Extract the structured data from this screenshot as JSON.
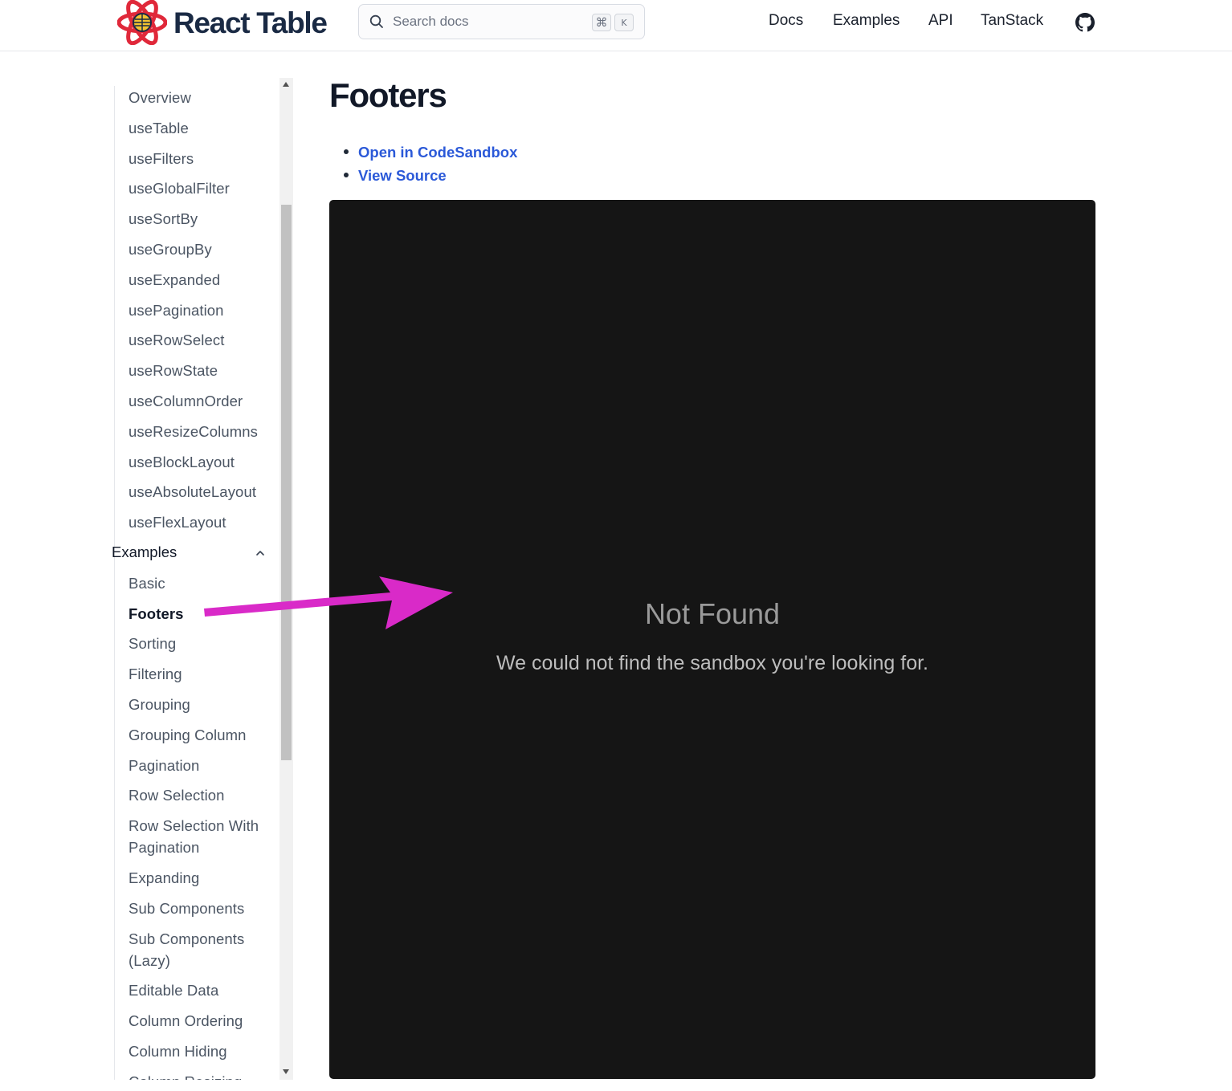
{
  "header": {
    "logo_text": "React Table",
    "search": {
      "placeholder": "Search docs",
      "shortcut_keys": [
        "⌘",
        "K"
      ]
    },
    "nav": [
      "Docs",
      "Examples",
      "API",
      "TanStack"
    ],
    "github_icon": "github-icon"
  },
  "sidebar": {
    "api_items": [
      "Overview",
      "useTable",
      "useFilters",
      "useGlobalFilter",
      "useSortBy",
      "useGroupBy",
      "useExpanded",
      "usePagination",
      "useRowSelect",
      "useRowState",
      "useColumnOrder",
      "useResizeColumns",
      "useBlockLayout",
      "useAbsoluteLayout",
      "useFlexLayout"
    ],
    "examples_section": "Examples",
    "example_items": [
      "Basic",
      "Footers",
      "Sorting",
      "Filtering",
      "Grouping",
      "Grouping Column",
      "Pagination",
      "Row Selection",
      "Row Selection With Pagination",
      "Expanding",
      "Sub Components",
      "Sub Components (Lazy)",
      "Editable Data",
      "Column Ordering",
      "Column Hiding",
      "Column Resizing"
    ],
    "active_item": "Footers"
  },
  "main": {
    "title": "Footers",
    "links": [
      "Open in CodeSandbox",
      "View Source"
    ],
    "sandbox": {
      "title": "Not Found",
      "message": "We could not find the sandbox you're looking for."
    }
  },
  "colors": {
    "link": "#2b59d8",
    "sandbox_bg": "#151515",
    "annotation_arrow": "#d92ac8"
  }
}
